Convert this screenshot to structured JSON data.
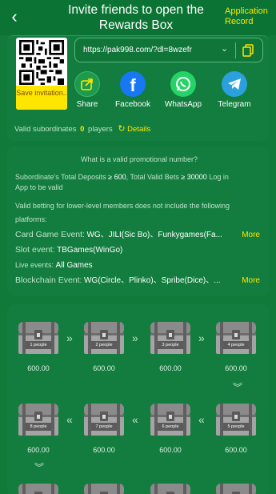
{
  "header": {
    "title": "Invite friends to open the Rewards Box",
    "record_label": "Application Record"
  },
  "invite": {
    "save_label": "Save invitation..",
    "link": "https://pak998.com/?dl=8wzefr",
    "share": [
      {
        "label": "Share",
        "icon": "share-icon",
        "color": "#0f7a3a"
      },
      {
        "label": "Facebook",
        "icon": "facebook-icon",
        "color": "#1877f2"
      },
      {
        "label": "WhatsApp",
        "icon": "whatsapp-icon",
        "color": "#25d366"
      },
      {
        "label": "Telegram",
        "icon": "telegram-icon",
        "color": "#2aa1de"
      }
    ],
    "valid_label": "Valid subordinates",
    "valid_count": "0",
    "valid_unit": "players",
    "details_label": "Details"
  },
  "rules": {
    "title": "What is a valid promotional number?",
    "line1_a": "Subordinate's Total Deposits",
    "line1_b": "≥ 600",
    "line1_c": ", Total Valid Bets",
    "line1_d": "≥ 30000",
    "line1_e": " Log in",
    "line1_f": "App to be valid",
    "line2": "Valid betting for lower-level members does not include the following",
    "line3": "platforms:",
    "card_label": "Card Game Event:",
    "card_value": "WG、JILI(Sic Bo)、Funkygames(Fa...",
    "slot_label": "Slot event:",
    "slot_value": "TBGames(WinGo)",
    "live_label": "Live events:",
    "live_value": "All Games",
    "block_label": "Blockchain Event:",
    "block_value": "WG(Circle、Plinko)、Spribe(Dice)、...",
    "more_label": "More"
  },
  "boxes": {
    "row1": [
      {
        "label": "1 people",
        "amount": "600.00"
      },
      {
        "label": "2 people",
        "amount": "600.00"
      },
      {
        "label": "3 people",
        "amount": "600.00"
      },
      {
        "label": "4 people",
        "amount": "600.00"
      }
    ],
    "row2": [
      {
        "label": "8 people",
        "amount": "600.00"
      },
      {
        "label": "7 people",
        "amount": "600.00"
      },
      {
        "label": "6 people",
        "amount": "600.00"
      },
      {
        "label": "5 people",
        "amount": "600.00"
      }
    ],
    "arrow_right": "»",
    "arrow_left": "«",
    "arrow_down": "︾"
  }
}
